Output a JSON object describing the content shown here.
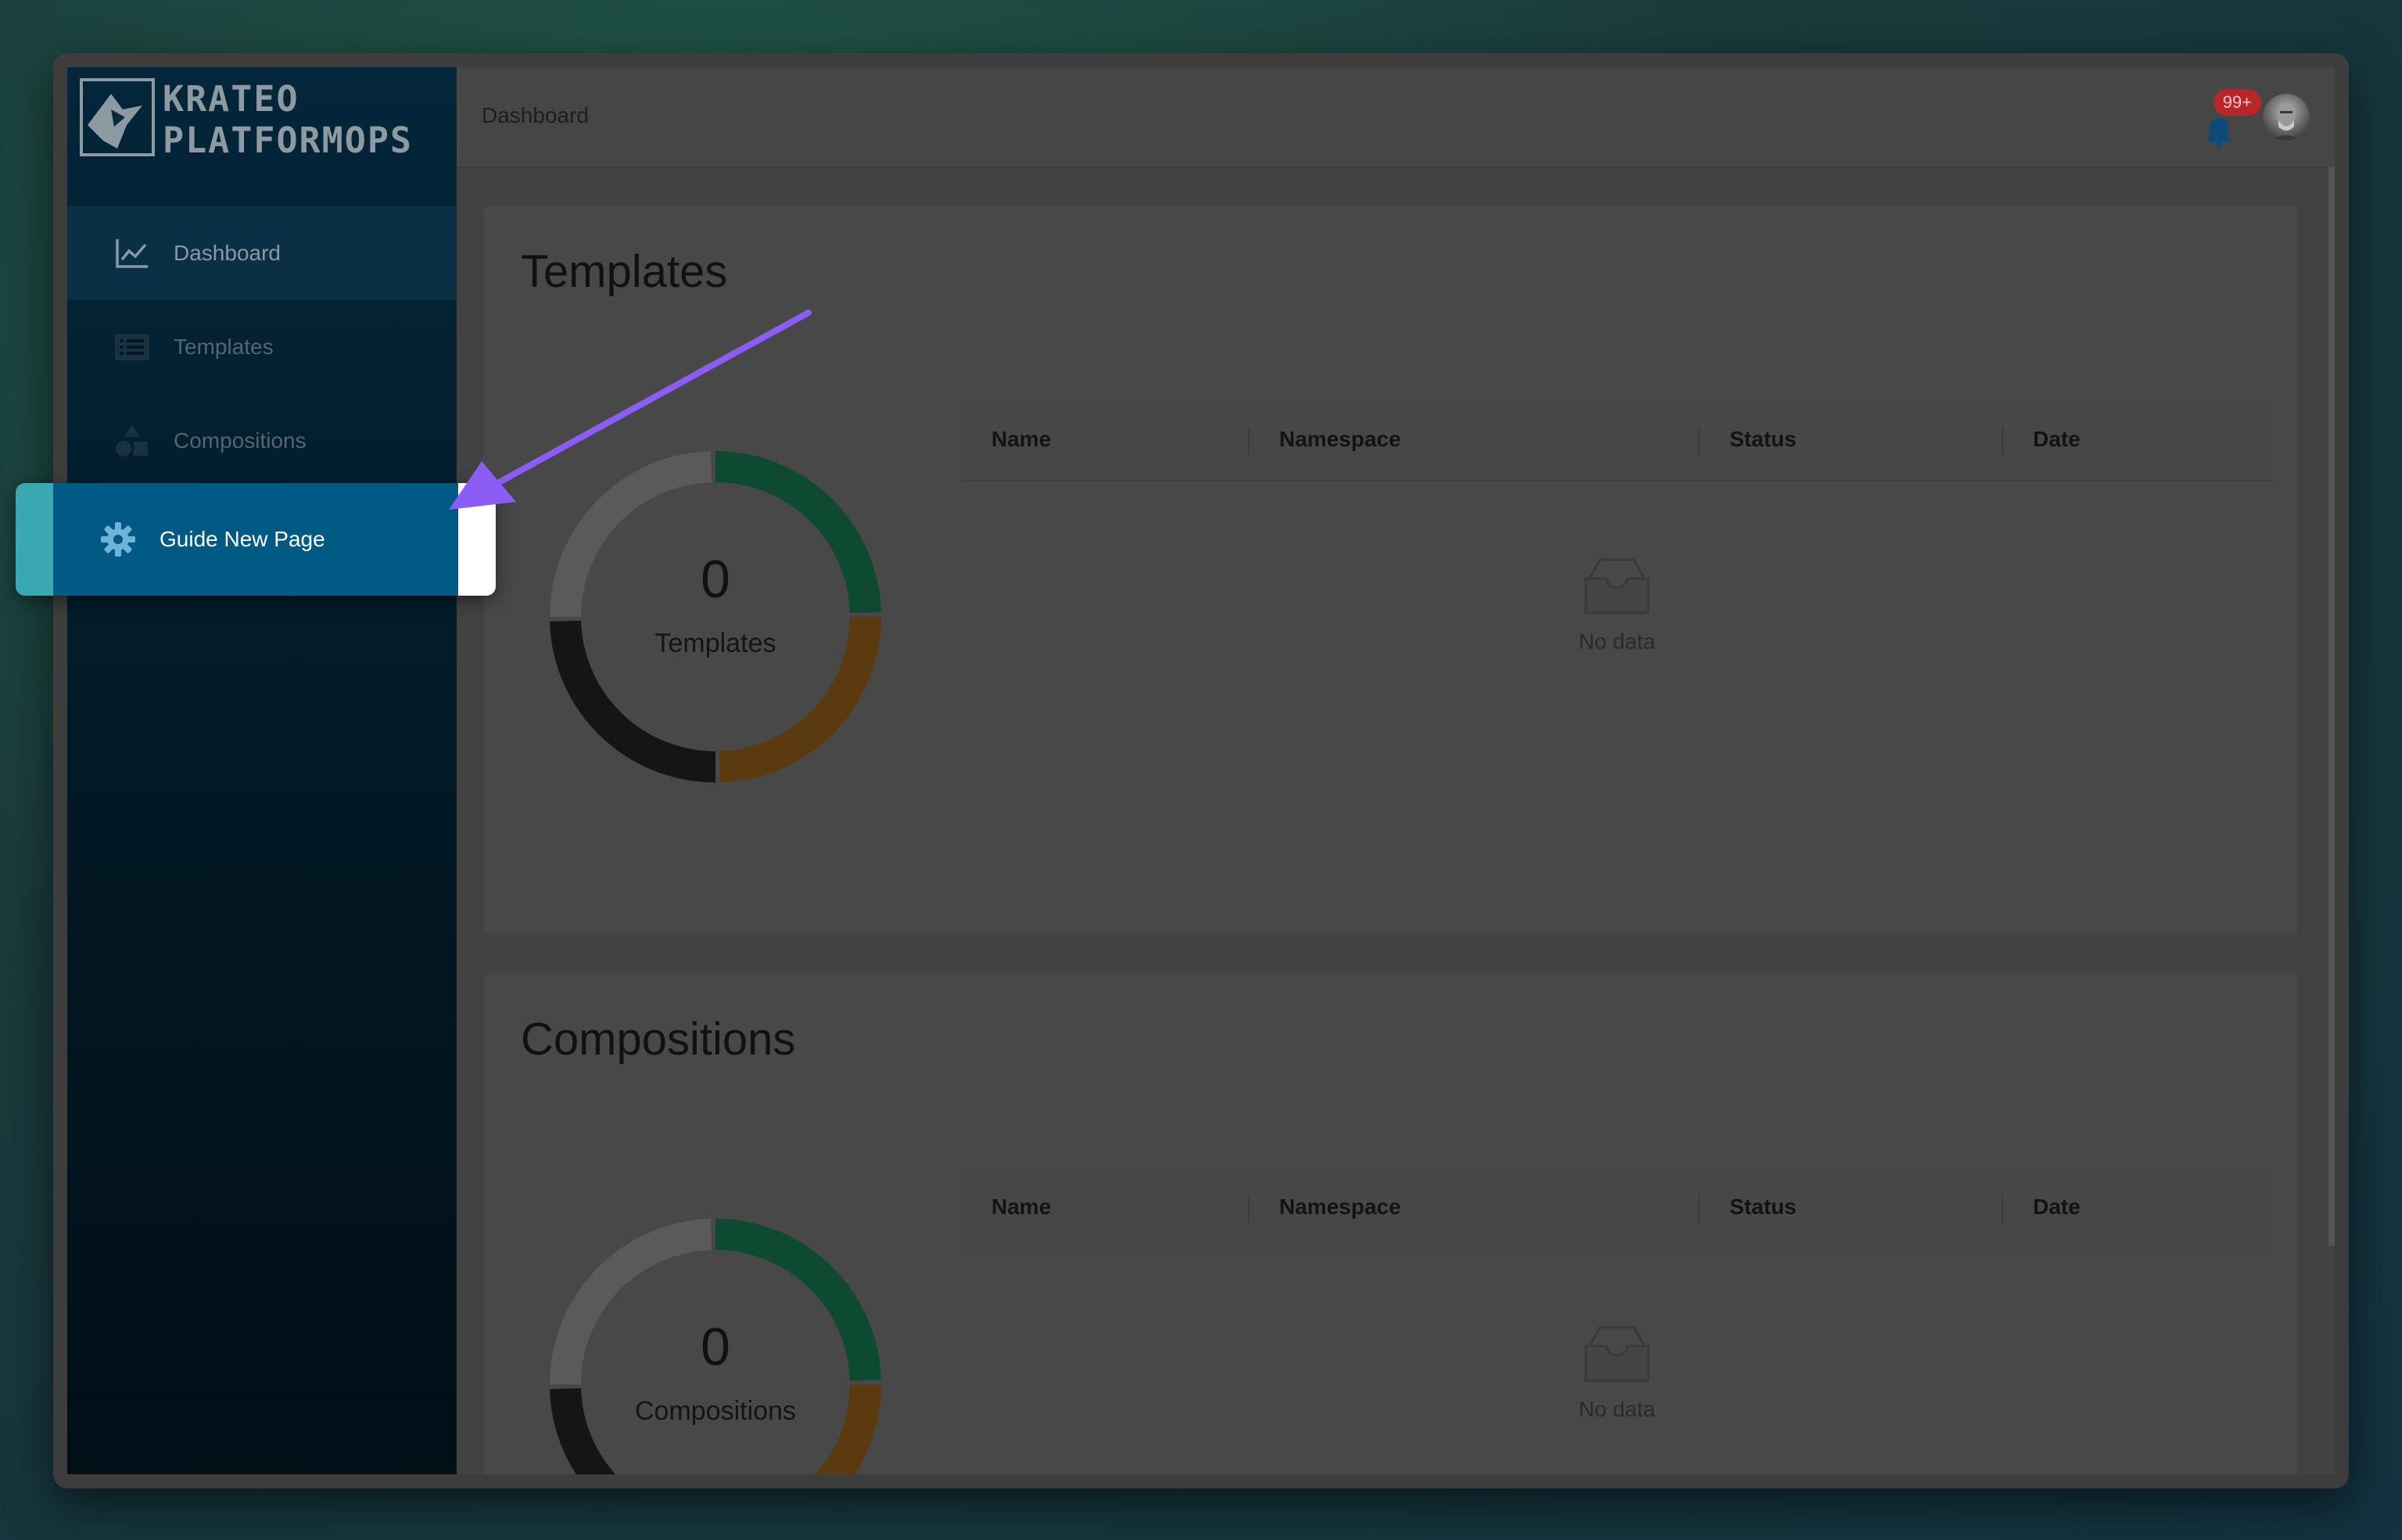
{
  "brand": {
    "line1": "KRATEO",
    "line2": "PLATFORMOPS"
  },
  "sidebar": {
    "items": [
      {
        "label": "Dashboard",
        "icon": "line-chart-icon"
      },
      {
        "label": "Templates",
        "icon": "list-icon"
      },
      {
        "label": "Compositions",
        "icon": "shapes-icon"
      },
      {
        "label": "Guide New Page",
        "icon": "gear-icon"
      }
    ]
  },
  "header": {
    "breadcrumb": "Dashboard",
    "notification_count": "99+"
  },
  "sections": [
    {
      "title": "Templates",
      "donut": {
        "count": "0",
        "label": "Templates"
      },
      "columns": [
        "Name",
        "Namespace",
        "Status",
        "Date"
      ],
      "empty_text": "No data"
    },
    {
      "title": "Compositions",
      "donut": {
        "count": "0",
        "label": "Compositions"
      },
      "columns": [
        "Name",
        "Namespace",
        "Status",
        "Date"
      ],
      "empty_text": "No data"
    }
  ],
  "colors": {
    "highlight": "#005a84",
    "accent_arrow": "#8b5cf6",
    "donut_green": "#0e4a32",
    "donut_orange": "#5a3a0e",
    "donut_dark": "#151515",
    "donut_gray": "#5a5a5a"
  }
}
